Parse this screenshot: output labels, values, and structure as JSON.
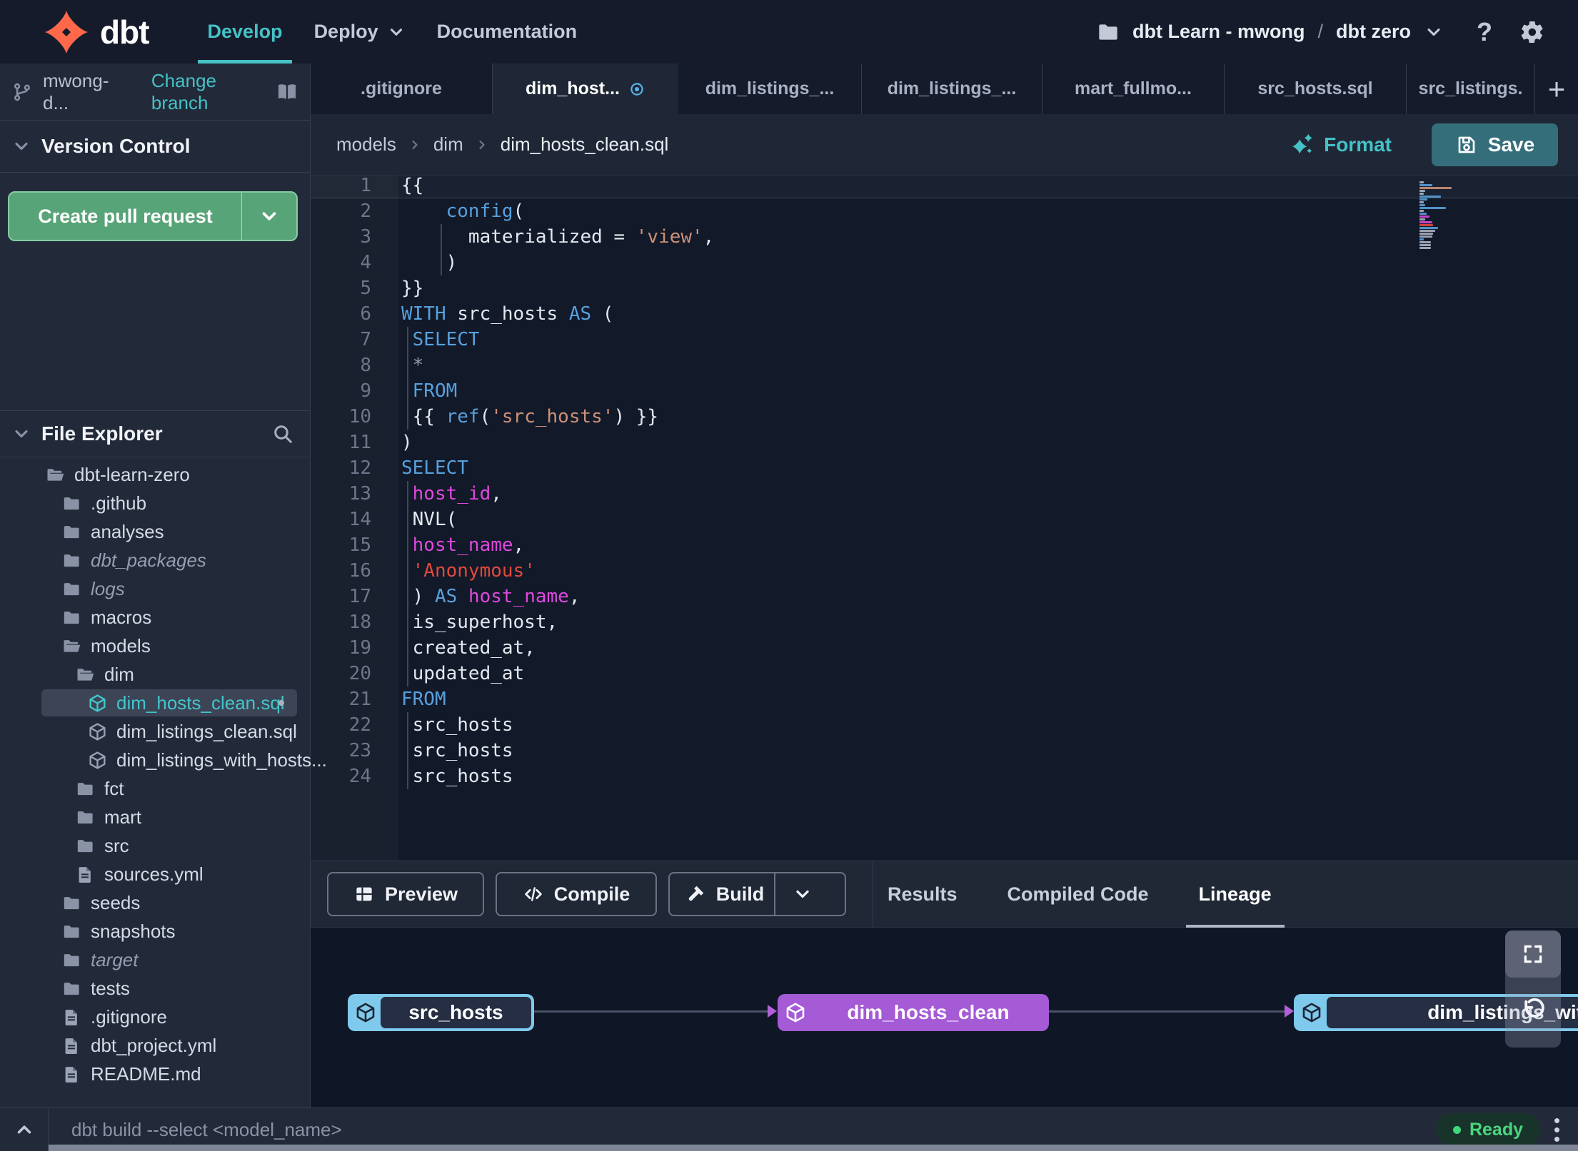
{
  "navbar": {
    "brand": "dbt",
    "items": [
      {
        "label": "Develop",
        "active": true
      },
      {
        "label": "Deploy",
        "chevron": true
      },
      {
        "label": "Documentation"
      }
    ],
    "project": {
      "account": "dbt Learn - mwong",
      "separator": "/",
      "name": "dbt zero"
    },
    "help_label": "?"
  },
  "sidebar": {
    "branch": {
      "name": "mwong-d...",
      "action": "Change branch"
    },
    "version_control": {
      "title": "Version Control",
      "cta": "Create pull request"
    },
    "file_explorer": {
      "title": "File Explorer",
      "tree": [
        {
          "label": "dbt-learn-zero",
          "type": "folder-open",
          "depth": 0
        },
        {
          "label": ".github",
          "type": "folder",
          "depth": 1
        },
        {
          "label": "analyses",
          "type": "folder",
          "depth": 1
        },
        {
          "label": "dbt_packages",
          "type": "folder",
          "depth": 1,
          "italic": true
        },
        {
          "label": "logs",
          "type": "folder",
          "depth": 1,
          "italic": true
        },
        {
          "label": "macros",
          "type": "folder",
          "depth": 1
        },
        {
          "label": "models",
          "type": "folder-open",
          "depth": 1
        },
        {
          "label": "dim",
          "type": "folder-open",
          "depth": 2
        },
        {
          "label": "dim_hosts_clean.sql",
          "type": "model",
          "depth": 3,
          "selected": true,
          "modified": true
        },
        {
          "label": "dim_listings_clean.sql",
          "type": "model",
          "depth": 3
        },
        {
          "label": "dim_listings_with_hosts...",
          "type": "model",
          "depth": 3
        },
        {
          "label": "fct",
          "type": "folder",
          "depth": 2
        },
        {
          "label": "mart",
          "type": "folder",
          "depth": 2
        },
        {
          "label": "src",
          "type": "folder",
          "depth": 2
        },
        {
          "label": "sources.yml",
          "type": "file",
          "depth": 2
        },
        {
          "label": "seeds",
          "type": "folder",
          "depth": 1
        },
        {
          "label": "snapshots",
          "type": "folder",
          "depth": 1
        },
        {
          "label": "target",
          "type": "folder",
          "depth": 1,
          "italic": true
        },
        {
          "label": "tests",
          "type": "folder",
          "depth": 1
        },
        {
          "label": ".gitignore",
          "type": "file",
          "depth": 1
        },
        {
          "label": "dbt_project.yml",
          "type": "file",
          "depth": 1
        },
        {
          "label": "README.md",
          "type": "file",
          "depth": 1
        }
      ]
    }
  },
  "tabs": {
    "items": [
      {
        "label": ".gitignore"
      },
      {
        "label": "dim_host...",
        "active": true,
        "unsaved": true
      },
      {
        "label": "dim_listings_..."
      },
      {
        "label": "dim_listings_..."
      },
      {
        "label": "mart_fullmo..."
      },
      {
        "label": "src_hosts.sql"
      },
      {
        "label": "src_listings."
      }
    ],
    "add_label": "+"
  },
  "editor": {
    "breadcrumb": [
      "models",
      "dim",
      "dim_hosts_clean.sql"
    ],
    "format_label": "Format",
    "save_label": "Save",
    "current_line": 1,
    "lines": [
      {
        "num": 1,
        "tokens": [
          [
            "{{",
            "p"
          ]
        ]
      },
      {
        "num": 2,
        "tokens": [
          [
            "    ",
            "p"
          ],
          [
            "config",
            "k"
          ],
          [
            "(",
            "p"
          ]
        ]
      },
      {
        "num": 3,
        "tokens": [
          [
            "      ",
            "p"
          ],
          [
            "materialized = ",
            "p"
          ],
          [
            "'view'",
            "s"
          ],
          [
            ",",
            "p"
          ]
        ]
      },
      {
        "num": 4,
        "tokens": [
          [
            "    )",
            "p"
          ]
        ]
      },
      {
        "num": 5,
        "tokens": [
          [
            "}}",
            "p"
          ]
        ]
      },
      {
        "num": 6,
        "tokens": [
          [
            "WITH",
            "k"
          ],
          [
            " src_hosts ",
            "p"
          ],
          [
            "AS",
            "k"
          ],
          [
            " (",
            "p"
          ]
        ]
      },
      {
        "num": 7,
        "tokens": [
          [
            " ",
            "p"
          ],
          [
            "SELECT",
            "k"
          ]
        ]
      },
      {
        "num": 8,
        "tokens": [
          [
            " ",
            "p"
          ],
          [
            "*",
            "d"
          ]
        ]
      },
      {
        "num": 9,
        "tokens": [
          [
            " ",
            "p"
          ],
          [
            "FROM",
            "k"
          ]
        ]
      },
      {
        "num": 10,
        "tokens": [
          [
            " {{ ",
            "p"
          ],
          [
            "ref",
            "k"
          ],
          [
            "(",
            "p"
          ],
          [
            "'src_hosts'",
            "s"
          ],
          [
            ") }}",
            "p"
          ]
        ]
      },
      {
        "num": 11,
        "tokens": [
          [
            ")",
            "p"
          ]
        ]
      },
      {
        "num": 12,
        "tokens": [
          [
            "SELECT",
            "k"
          ]
        ]
      },
      {
        "num": 13,
        "tokens": [
          [
            " ",
            "p"
          ],
          [
            "host_id",
            "m"
          ],
          [
            ",",
            "p"
          ]
        ]
      },
      {
        "num": 14,
        "tokens": [
          [
            " NVL(",
            "p"
          ]
        ]
      },
      {
        "num": 15,
        "tokens": [
          [
            " ",
            "p"
          ],
          [
            "host_name",
            "m"
          ],
          [
            ",",
            "p"
          ]
        ]
      },
      {
        "num": 16,
        "tokens": [
          [
            " ",
            "p"
          ],
          [
            "'Anonymous'",
            "r"
          ]
        ]
      },
      {
        "num": 17,
        "tokens": [
          [
            " ) ",
            "p"
          ],
          [
            "AS",
            "k"
          ],
          [
            " ",
            "p"
          ],
          [
            "host_name",
            "m"
          ],
          [
            ",",
            "p"
          ]
        ]
      },
      {
        "num": 18,
        "tokens": [
          [
            " is_superhost,",
            "p"
          ]
        ]
      },
      {
        "num": 19,
        "tokens": [
          [
            " created_at,",
            "p"
          ]
        ]
      },
      {
        "num": 20,
        "tokens": [
          [
            " updated_at",
            "p"
          ]
        ]
      },
      {
        "num": 21,
        "tokens": [
          [
            "FROM",
            "k"
          ]
        ]
      },
      {
        "num": 22,
        "tokens": [
          [
            " src_hosts",
            "p"
          ]
        ]
      },
      {
        "num": 23,
        "tokens": [
          [
            " src_hosts",
            "p"
          ]
        ]
      },
      {
        "num": 24,
        "tokens": [
          [
            " src_hosts",
            "p"
          ]
        ]
      }
    ]
  },
  "panel": {
    "buttons": [
      {
        "label": "Preview",
        "icon": "grid"
      },
      {
        "label": "Compile",
        "icon": "code"
      },
      {
        "label": "Build",
        "icon": "hammer",
        "split": true
      }
    ],
    "tabs": [
      {
        "label": "Results"
      },
      {
        "label": "Compiled Code"
      },
      {
        "label": "Lineage",
        "active": true
      }
    ]
  },
  "lineage": {
    "nodes": [
      {
        "label": "src_hosts",
        "color": "blue"
      },
      {
        "label": "dim_hosts_clean",
        "color": "purple"
      },
      {
        "label": "dim_listings_with_h",
        "color": "blue",
        "clipped": true
      }
    ]
  },
  "command_bar": {
    "placeholder": "dbt build --select <model_name>",
    "status": "Ready"
  },
  "colors": {
    "accent_teal": "#45c2c6",
    "green_button": "#57a478",
    "save_teal": "#356e7b",
    "node_blue": "#7fc9ec",
    "node_purple": "#a55ad6",
    "status_green": "#4bd680",
    "unsaved_blue": "#56b5e8",
    "edge": "#4a5267",
    "arrow": "#b35fd9",
    "tokens": {
      "p": "#e3e7ee",
      "k": "#58a0dc",
      "s": "#cc9178",
      "r": "#e2493b",
      "m": "#dd49dd",
      "d": "#9aa2b2"
    }
  }
}
